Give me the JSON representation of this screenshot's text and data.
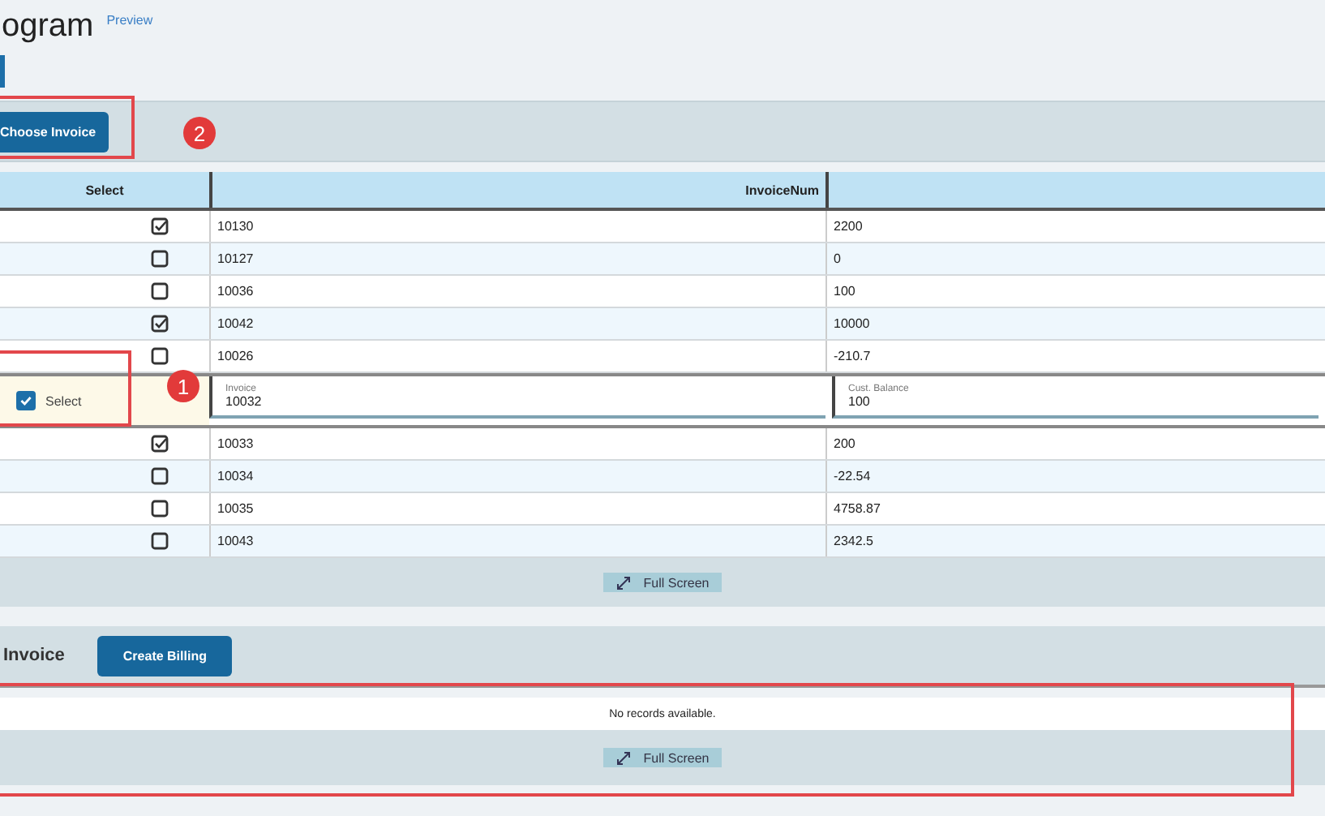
{
  "page": {
    "title": "ogram",
    "badge": "Preview"
  },
  "toolbar": {
    "button": "Choose Invoice"
  },
  "table": {
    "columns": [
      "Select",
      "InvoiceNum"
    ],
    "rows": [
      {
        "kind": "row",
        "checked": true,
        "invoice": "10130",
        "column_3": "2200"
      },
      {
        "kind": "row",
        "checked": false,
        "invoice": "10127",
        "column_3": "0"
      },
      {
        "kind": "row",
        "checked": false,
        "invoice": "10036",
        "column_3": "100"
      },
      {
        "kind": "row",
        "checked": true,
        "invoice": "10042",
        "column_3": "10000"
      },
      {
        "kind": "row",
        "checked": false,
        "invoice": "10026",
        "column_3": "-210.7"
      },
      {
        "kind": "edit",
        "checked": true,
        "select_label": "Select",
        "invoice_label": "Invoice",
        "invoice": "10032",
        "balance_label": "Cust. Balance",
        "column_3": "100"
      },
      {
        "kind": "row",
        "checked": true,
        "invoice": "10033",
        "column_3": "200"
      },
      {
        "kind": "row",
        "checked": false,
        "invoice": "10034",
        "column_3": "-22.54"
      },
      {
        "kind": "row",
        "checked": false,
        "invoice": "10035",
        "column_3": "4758.87"
      },
      {
        "kind": "row",
        "checked": false,
        "invoice": "10043",
        "column_3": "2342.5"
      }
    ],
    "footer_button": "Full Screen"
  },
  "section": {
    "title": "Invoice",
    "button": "Create Billing",
    "empty_text": "No records available.",
    "footer_button": "Full Screen"
  },
  "annotations": [
    {
      "number": "2"
    },
    {
      "number": "1"
    }
  ]
}
